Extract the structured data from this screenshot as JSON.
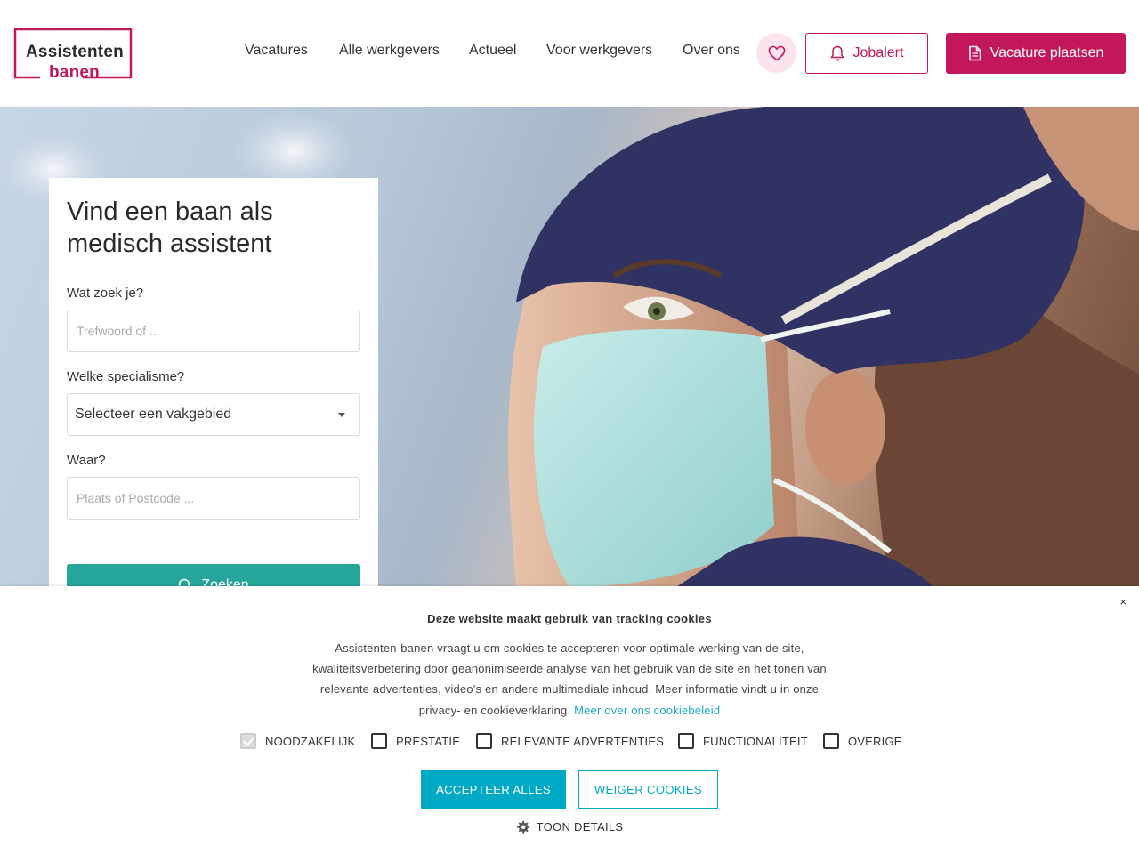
{
  "logo": {
    "line1": "Assistenten",
    "line2": "banen"
  },
  "nav": {
    "items": [
      "Vacatures",
      "Alle werkgevers",
      "Actueel",
      "Voor werkgevers",
      "Over ons"
    ]
  },
  "header": {
    "jobalert_label": "Jobalert",
    "vacature_label": "Vacature plaatsen"
  },
  "search": {
    "title": "Vind een baan als medisch assistent",
    "what_label": "Wat zoek je?",
    "what_placeholder": "Trefwoord of ...",
    "specialism_label": "Welke specialisme?",
    "specialism_value": "Selecteer een vakgebied",
    "where_label": "Waar?",
    "where_placeholder": "Plaats of Postcode ...",
    "button_label": "Zoeken"
  },
  "cookie": {
    "close": "×",
    "title": "Deze website maakt gebruik van tracking cookies",
    "body": "Assistenten-banen vraagt u om cookies te accepteren voor optimale werking van de site, kwaliteitsverbetering door geanonimiseerde analyse van het gebruik van de site en het tonen van relevante advertenties, video's en andere multimediale inhoud. Meer informatie vindt u in onze privacy- en cookieverklaring.",
    "link": "Meer over ons cookiebeleid",
    "checkboxes": [
      "NOODZAKELIJK",
      "PRESTATIE",
      "RELEVANTE ADVERTENTIES",
      "FUNCTIONALITEIT",
      "OVERIGE"
    ],
    "accept": "ACCEPTEER ALLES",
    "refuse": "WEIGER COOKIES",
    "details": "TOON DETAILS"
  },
  "colors": {
    "brand": "#c2185b",
    "teal": "#26a69a",
    "cookie_accent": "#00a9c4"
  }
}
